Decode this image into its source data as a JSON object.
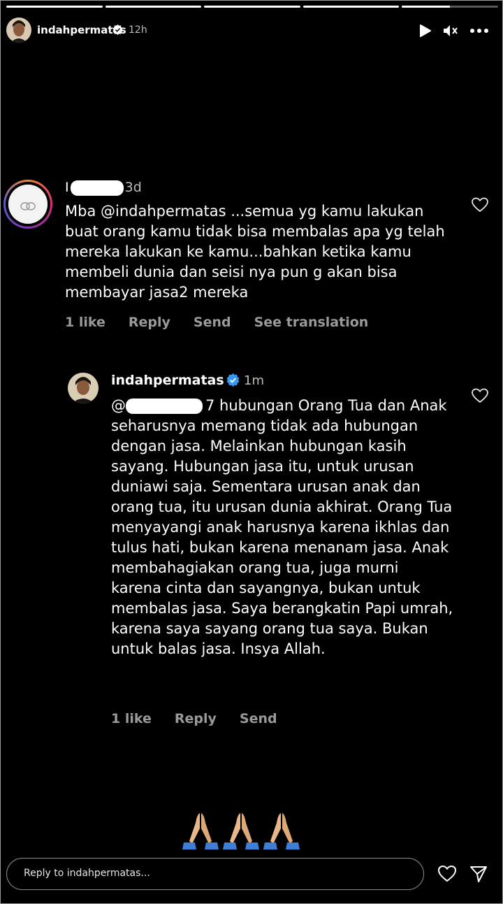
{
  "story": {
    "progress": [
      1,
      1,
      1,
      1,
      0.5
    ],
    "username": "indahpermatas",
    "time": "12h"
  },
  "comment": {
    "name_prefix": "I",
    "time": "3d",
    "text": "Mba @indahpermatas ...semua yg kamu lakukan buat orang kamu tidak bisa membalas apa yg telah mereka lakukan ke kamu...bahkan ketika kamu membeli dunia dan seisi nya pun g akan bisa membayar jasa2 mereka",
    "actions": {
      "likes": "1 like",
      "reply": "Reply",
      "send": "Send",
      "translate": "See translation"
    }
  },
  "reply": {
    "username": "indahpermatas",
    "time": "1m",
    "mention_prefix": "@",
    "mention_suffix": "7",
    "text": " hubungan Orang Tua dan Anak seharusnya memang tidak ada hubungan dengan jasa. Melainkan hubungan kasih sayang. Hubungan jasa itu, untuk urusan duniawi saja. Sementara urusan anak dan orang tua, itu urusan dunia akhirat. Orang Tua menyayangi anak harusnya karena ikhlas dan tulus hati, bukan karena menanam jasa. Anak membahagiakan orang tua, juga murni karena cinta dan sayangnya, bukan untuk membalas jasa. Saya berangkatin Papi umrah, karena saya sayang orang tua saya. Bukan untuk balas jasa. Insya Allah.",
    "actions": {
      "likes": "1 like",
      "reply": "Reply",
      "send": "Send"
    }
  },
  "emojis": [
    "folded-hands-emoji",
    "folded-hands-emoji",
    "folded-hands-emoji"
  ],
  "footer": {
    "placeholder": "Reply to indahpermatas..."
  },
  "colors": {
    "verified": "#3897f0",
    "muted": "#9a9a9a",
    "skin": "#e8b88a"
  }
}
